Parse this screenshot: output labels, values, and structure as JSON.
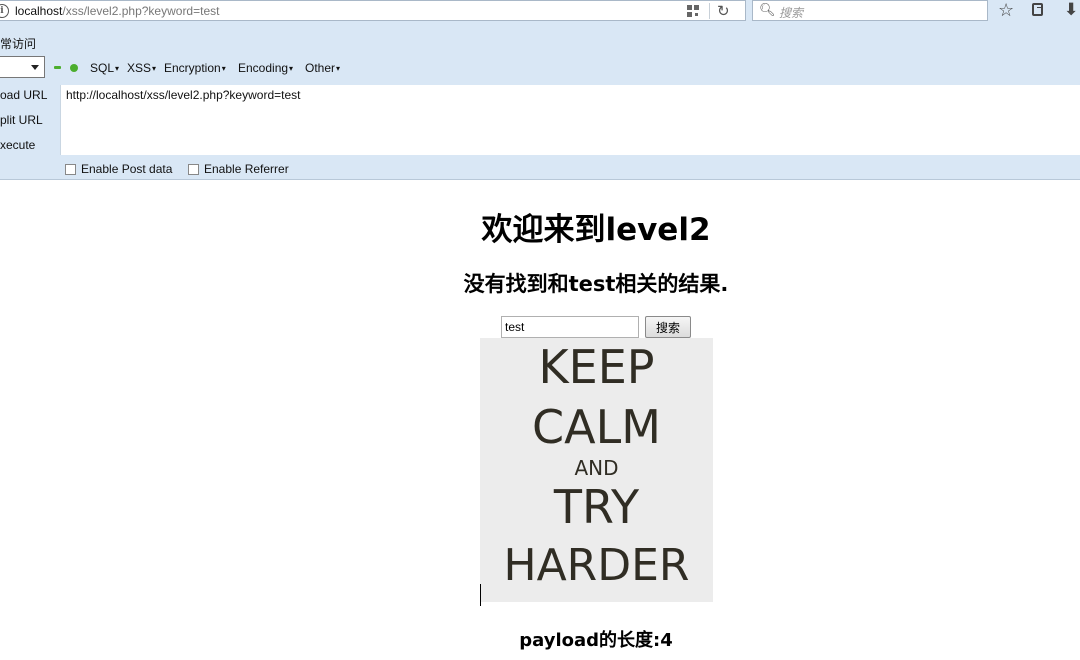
{
  "browser": {
    "url_host": "localhost",
    "url_path": "/xss/level2.php?keyword=test",
    "search_placeholder": "搜索"
  },
  "bookmarks": {
    "item": "常访问"
  },
  "hackbar": {
    "menus": [
      "SQL",
      "XSS",
      "Encryption",
      "Encoding",
      "Other"
    ],
    "side_buttons": [
      "oad URL",
      "plit URL",
      "xecute"
    ],
    "url_value": "http://localhost/xss/level2.php?keyword=test",
    "enable_post": "Enable Post data",
    "enable_referrer": "Enable Referrer"
  },
  "page": {
    "title": "欢迎来到level2",
    "result": "没有找到和test相关的结果.",
    "search_value": "test",
    "search_button": "搜索",
    "poster_lines": [
      "KEEP",
      "CALM",
      "AND",
      "TRY",
      "HARDER"
    ],
    "payload_length": "payload的长度:4"
  }
}
